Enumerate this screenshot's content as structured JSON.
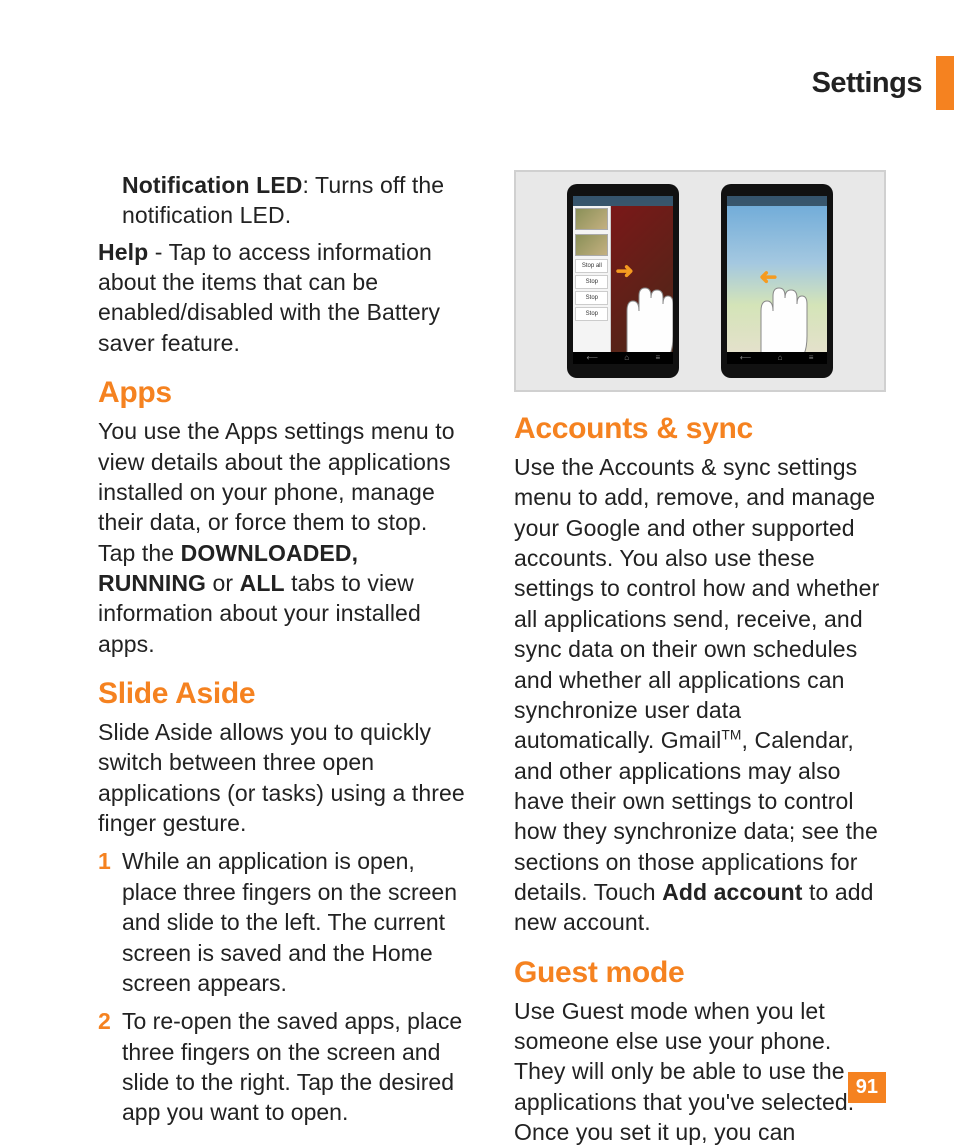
{
  "header": {
    "title": "Settings"
  },
  "page_number": "91",
  "left": {
    "notif_led_label": "Notification LED",
    "notif_led_desc": ": Turns off the notification LED.",
    "help_label": "Help",
    "help_desc": " - Tap to access information about the items that can be enabled/disabled with the Battery saver feature.",
    "apps": {
      "heading": "Apps",
      "body_pre": "You use the Apps settings menu to view details about the applications installed on your phone, manage their data, or force them to stop. Tap the ",
      "bold1": "DOWNLOADED, RUNNING",
      "mid": " or ",
      "bold2": "ALL",
      "body_post": " tabs to view information about your installed apps."
    },
    "slide": {
      "heading": "Slide Aside",
      "body": "Slide Aside allows you to quickly switch between three open applications (or tasks) using a three finger gesture.",
      "steps": [
        "While an application is open, place three fingers on the screen and slide to the left. The current screen is saved and the Home screen appears.",
        "To re-open the saved apps, place three fingers on the screen and slide to the right. Tap the desired app you want to open."
      ]
    }
  },
  "right": {
    "figure": {
      "phone1_buttons": [
        "Stop all",
        "Stop",
        "Stop",
        "Stop"
      ]
    },
    "accounts": {
      "heading": "Accounts & sync",
      "body_pre": "Use the Accounts & sync settings menu to add, remove, and manage your Google and other supported accounts. You also use these settings to control how and whether all applications send, receive, and sync data on their own schedules and whether all applications can synchronize user data automatically. Gmail",
      "tm": "TM",
      "body_mid": ", Calendar, and other applications may also have their own settings to control how they synchronize data; see the sections on those applications for details. Touch ",
      "bold1": "Add account",
      "body_post": " to add new account."
    },
    "guest": {
      "heading": "Guest mode",
      "body": "Use Guest mode when you let someone else use your phone. They will only be able to use the applications that you've selected. Once you set it up, you can"
    }
  }
}
